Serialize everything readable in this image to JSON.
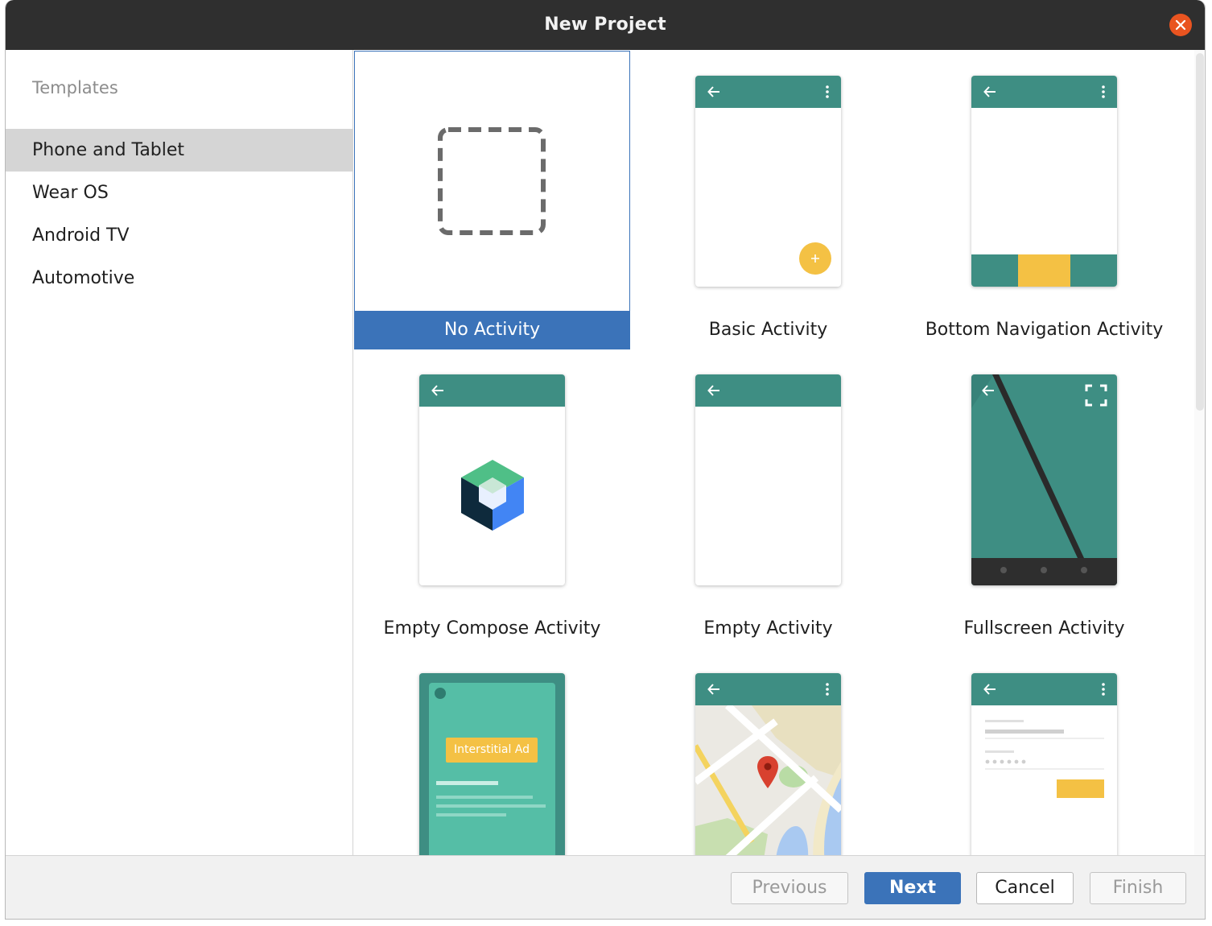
{
  "window": {
    "title": "New Project"
  },
  "sidebar": {
    "heading": "Templates",
    "items": [
      {
        "label": "Phone and Tablet",
        "selected": true
      },
      {
        "label": "Wear OS",
        "selected": false
      },
      {
        "label": "Android TV",
        "selected": false
      },
      {
        "label": "Automotive",
        "selected": false
      }
    ]
  },
  "templates": [
    {
      "label": "No Activity",
      "selected": true,
      "icon": "dashed-box-icon"
    },
    {
      "label": "Basic Activity",
      "selected": false,
      "icon": "basic-activity-preview"
    },
    {
      "label": "Bottom Navigation Activity",
      "selected": false,
      "icon": "bottom-nav-preview"
    },
    {
      "label": "Empty Compose Activity",
      "selected": false,
      "icon": "jetpack-compose-logo"
    },
    {
      "label": "Empty Activity",
      "selected": false,
      "icon": "empty-activity-preview"
    },
    {
      "label": "Fullscreen Activity",
      "selected": false,
      "icon": "fullscreen-preview"
    },
    {
      "label": "",
      "selected": false,
      "icon": "interstitial-ad-preview",
      "badge": "Interstitial Ad"
    },
    {
      "label": "",
      "selected": false,
      "icon": "maps-preview"
    },
    {
      "label": "",
      "selected": false,
      "icon": "login-preview"
    }
  ],
  "footer": {
    "previous": "Previous",
    "next": "Next",
    "cancel": "Cancel",
    "finish": "Finish"
  },
  "colors": {
    "accent": "#3b73b9",
    "toolbar": "#3e8e83",
    "fab": "#f4c144",
    "titlebar": "#2f2f2f",
    "close": "#e95420"
  }
}
